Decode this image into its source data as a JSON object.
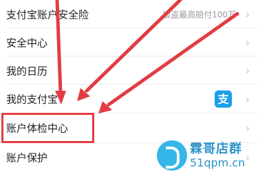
{
  "menu": {
    "items": [
      {
        "label": "支付宝账户安全险",
        "sub": "被盗最高赔付100万",
        "chevron": "›"
      },
      {
        "label": "安全中心",
        "chevron": "›"
      },
      {
        "label": "我的日历",
        "chevron": "›"
      },
      {
        "label": "我的支付宝",
        "icon": "alipay-icon",
        "icon_text": "支",
        "chevron": "›"
      },
      {
        "label": "账户体检中心",
        "chevron": "›"
      },
      {
        "label": "账户保护",
        "chevron": "›"
      }
    ]
  },
  "annotation": {
    "color": "#e23c43"
  },
  "watermark": {
    "title": "霖哥店群",
    "url": "51qpm.cn"
  }
}
